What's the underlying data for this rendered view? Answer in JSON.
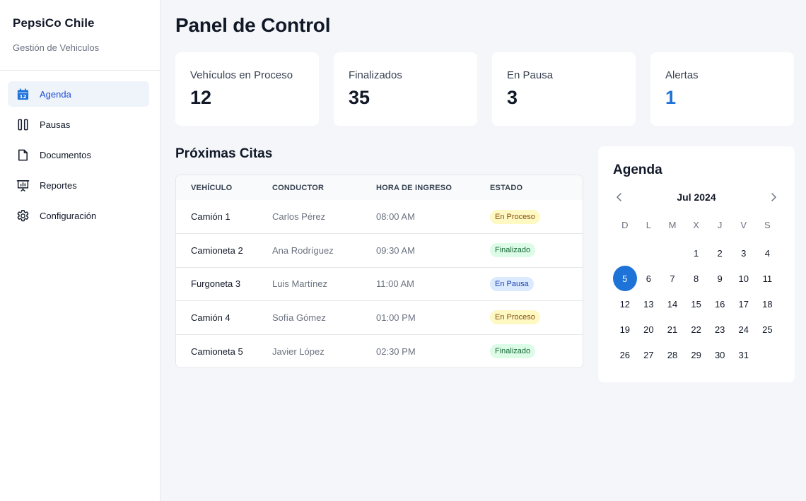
{
  "brand": {
    "title": "PepsiCo Chile",
    "subtitle": "Gestión de Vehiculos"
  },
  "sidebar": {
    "items": [
      {
        "label": "Agenda",
        "icon": "calendar-icon",
        "active": true
      },
      {
        "label": "Pausas",
        "icon": "pause-icon",
        "active": false
      },
      {
        "label": "Documentos",
        "icon": "document-icon",
        "active": false
      },
      {
        "label": "Reportes",
        "icon": "presentation-chart-icon",
        "active": false
      },
      {
        "label": "Configuración",
        "icon": "gear-icon",
        "active": false
      }
    ]
  },
  "page": {
    "title": "Panel de Control"
  },
  "stats": [
    {
      "label": "Vehículos en Proceso",
      "value": "12"
    },
    {
      "label": "Finalizados",
      "value": "35"
    },
    {
      "label": "En Pausa",
      "value": "3"
    },
    {
      "label": "Alertas",
      "value": "1",
      "color": "#1e73d8"
    }
  ],
  "appointments": {
    "title": "Próximas Citas",
    "columns": [
      "VEHÍCULO",
      "CONDUCTOR",
      "HORA DE INGRESO",
      "ESTADO"
    ],
    "rows": [
      {
        "vehicle": "Camión 1",
        "driver": "Carlos Pérez",
        "time": "08:00 AM",
        "status": "En Proceso"
      },
      {
        "vehicle": "Camioneta 2",
        "driver": "Ana Rodríguez",
        "time": "09:30 AM",
        "status": "Finalizado"
      },
      {
        "vehicle": "Furgoneta 3",
        "driver": "Luis Martínez",
        "time": "11:00 AM",
        "status": "En Pausa"
      },
      {
        "vehicle": "Camión 4",
        "driver": "Sofía Gómez",
        "time": "01:00 PM",
        "status": "En Proceso"
      },
      {
        "vehicle": "Camioneta 5",
        "driver": "Javier López",
        "time": "02:30 PM",
        "status": "Finalizado"
      }
    ]
  },
  "calendar": {
    "title": "Agenda",
    "month": "Jul 2024",
    "prev_icon": "chevron-left-icon",
    "next_icon": "chevron-right-icon",
    "weekdays": [
      "D",
      "L",
      "M",
      "X",
      "J",
      "V",
      "S"
    ],
    "days": [
      "",
      "",
      "",
      "1",
      "2",
      "3",
      "4",
      "5",
      "6",
      "7",
      "8",
      "9",
      "10",
      "11",
      "12",
      "13",
      "14",
      "15",
      "16",
      "17",
      "18",
      "19",
      "20",
      "21",
      "22",
      "23",
      "24",
      "25",
      "26",
      "27",
      "28",
      "29",
      "30",
      "31"
    ],
    "selected": "5",
    "accent": "#1e73d8"
  }
}
